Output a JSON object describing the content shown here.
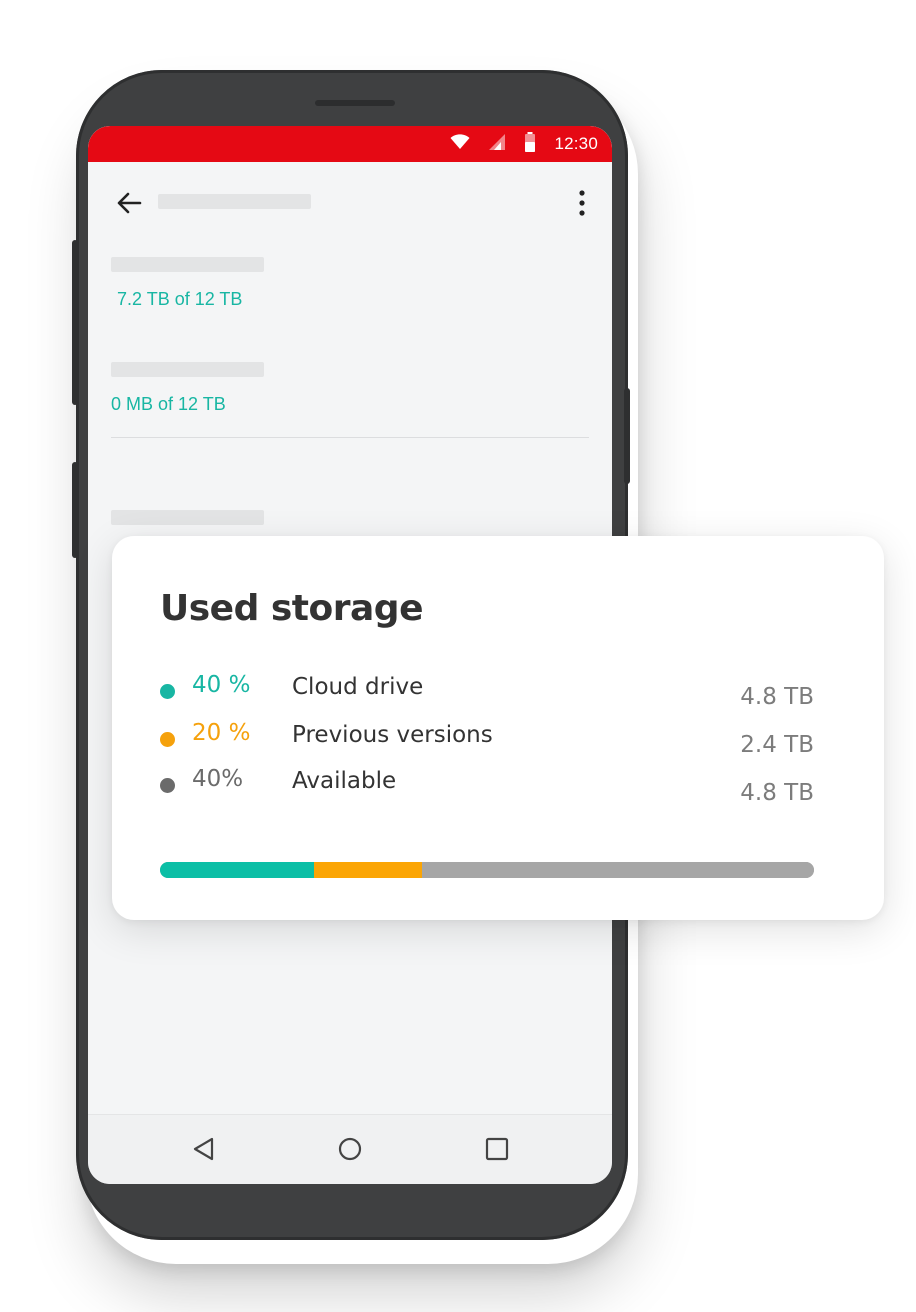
{
  "colors": {
    "status_bar": "#e50914",
    "teal": "#18b6a3",
    "orange": "#f5a10c",
    "gray": "#6b6b6b",
    "bar_teal": "#0bbfa6",
    "bar_orange": "#fba505",
    "bar_gray": "#a6a6a6"
  },
  "status_bar": {
    "time": "12:30",
    "icons": [
      "wifi-icon",
      "signal-icon",
      "battery-icon"
    ]
  },
  "app_bar": {
    "back_icon": "arrow-back-icon",
    "more_icon": "more-vert-icon"
  },
  "content": {
    "storage_1": "7.2 TB of 12 TB",
    "storage_2": "0 MB of 12 TB"
  },
  "nav_bar": {
    "icons": [
      "nav-back-icon",
      "nav-home-icon",
      "nav-recent-icon"
    ]
  },
  "card": {
    "title": "Used storage",
    "rows": [
      {
        "percent": "40 %",
        "label": "Cloud drive",
        "size": "4.8 TB",
        "color": "#18b6a3"
      },
      {
        "percent": "20 %",
        "label": "Previous versions",
        "size": "2.4 TB",
        "color": "#f5a10c"
      },
      {
        "percent": "40%",
        "label": "Available",
        "size": "4.8 TB",
        "color": "#6b6b6b"
      }
    ],
    "usage_bar": {
      "segments": [
        {
          "name": "cloud-drive",
          "fraction": 0.235,
          "color": "#0bbfa6"
        },
        {
          "name": "previous-versions",
          "fraction": 0.165,
          "color": "#fba505"
        },
        {
          "name": "available",
          "fraction": 0.6,
          "color": "#a6a6a6"
        }
      ]
    }
  }
}
